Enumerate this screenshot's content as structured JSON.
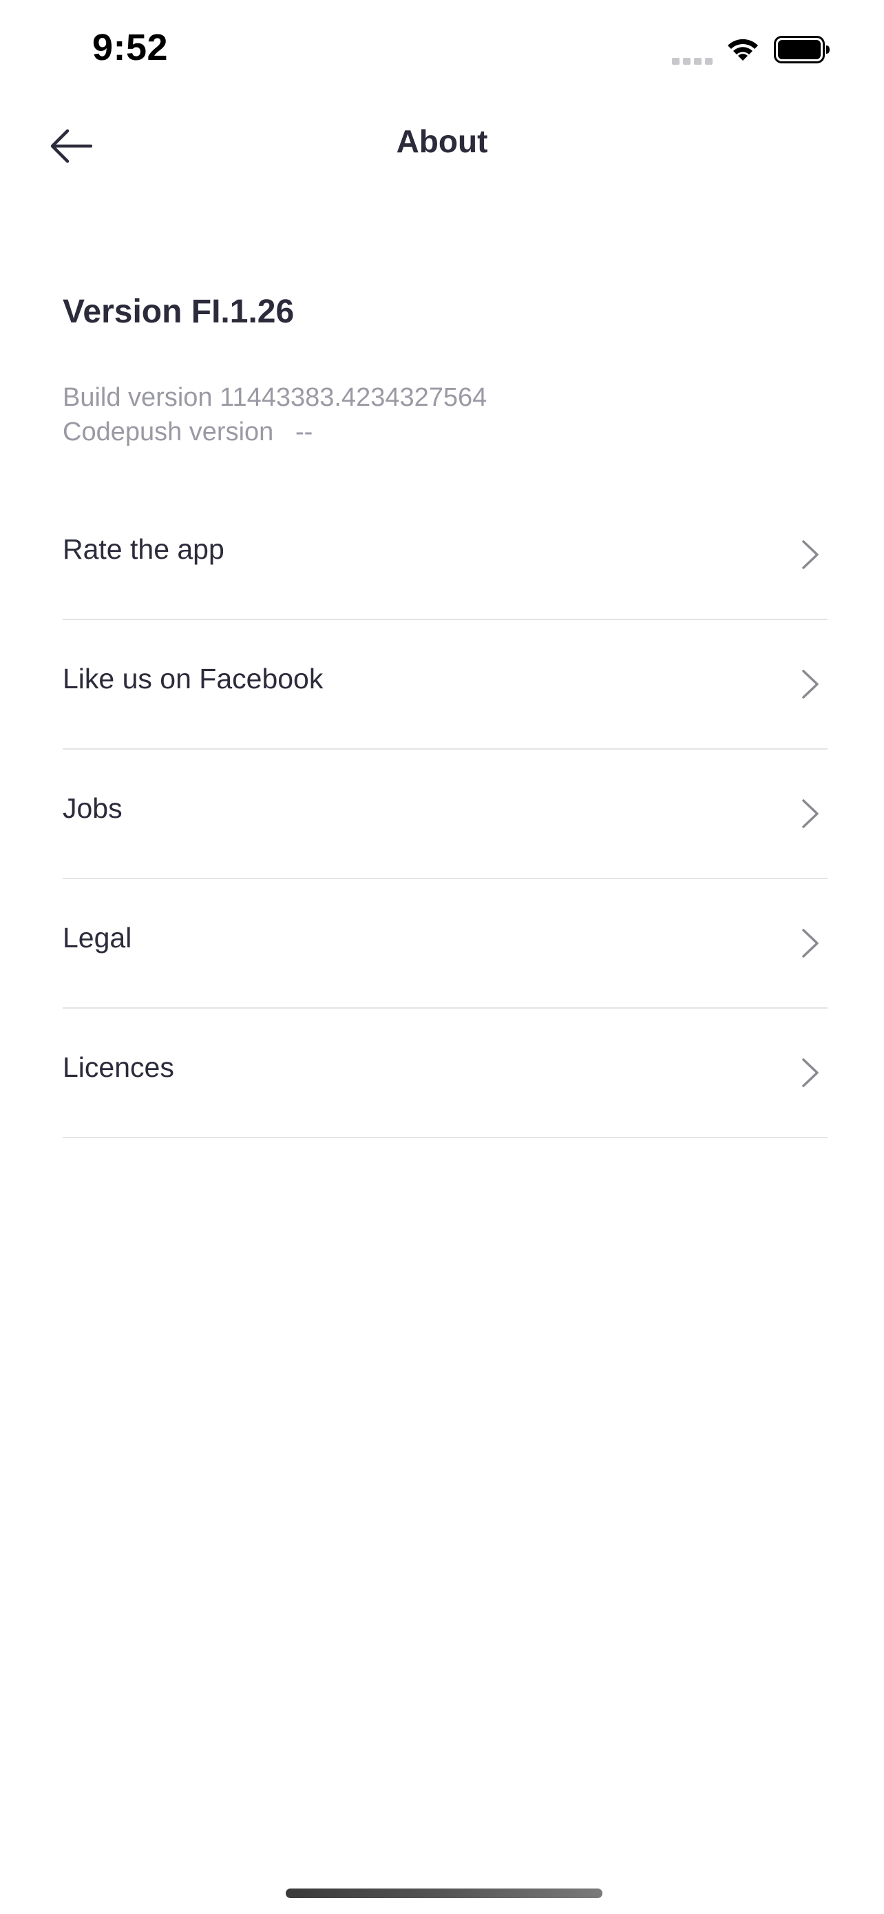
{
  "status_bar": {
    "time": "9:52",
    "icons": [
      "cellular-signal-icon",
      "wifi-icon",
      "battery-icon"
    ]
  },
  "nav": {
    "back_icon": "arrow-left-icon",
    "title": "About"
  },
  "version": {
    "title": "Version FI.1.26",
    "build_label": "Build version",
    "build_value": "11443383.4234327564",
    "codepush_label": "Codepush version",
    "codepush_value": "--"
  },
  "menu": {
    "items": [
      {
        "label": "Rate the app",
        "icon": "chevron-right-icon"
      },
      {
        "label": "Like us on Facebook",
        "icon": "chevron-right-icon"
      },
      {
        "label": "Jobs",
        "icon": "chevron-right-icon"
      },
      {
        "label": "Legal",
        "icon": "chevron-right-icon"
      },
      {
        "label": "Licences",
        "icon": "chevron-right-icon"
      }
    ]
  },
  "colors": {
    "text_primary": "#2b2b3b",
    "text_secondary": "#9a9aa4",
    "divider": "#e4e4e8",
    "chevron": "#8a8a90",
    "background": "#ffffff"
  }
}
